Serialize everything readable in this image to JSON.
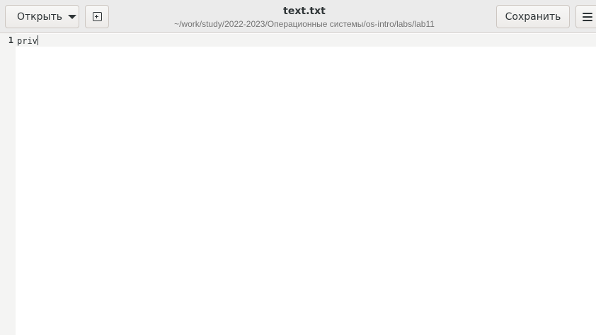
{
  "header": {
    "open_label": "Открыть",
    "save_label": "Сохранить",
    "title": "text.txt",
    "subtitle": "~/work/study/2022-2023/Операционные системы/os-intro/labs/lab11"
  },
  "icons": {
    "open_dropdown": "chevron-down-icon",
    "new_document": "new-tab-icon",
    "menu": "hamburger-menu-icon"
  },
  "editor": {
    "lines": [
      {
        "number": "1",
        "text": "priv"
      }
    ]
  },
  "colors": {
    "headerbar": "#ebebeb",
    "gutter": "#f4f4f3",
    "text": "#2e3436",
    "subtitle": "#747474"
  }
}
